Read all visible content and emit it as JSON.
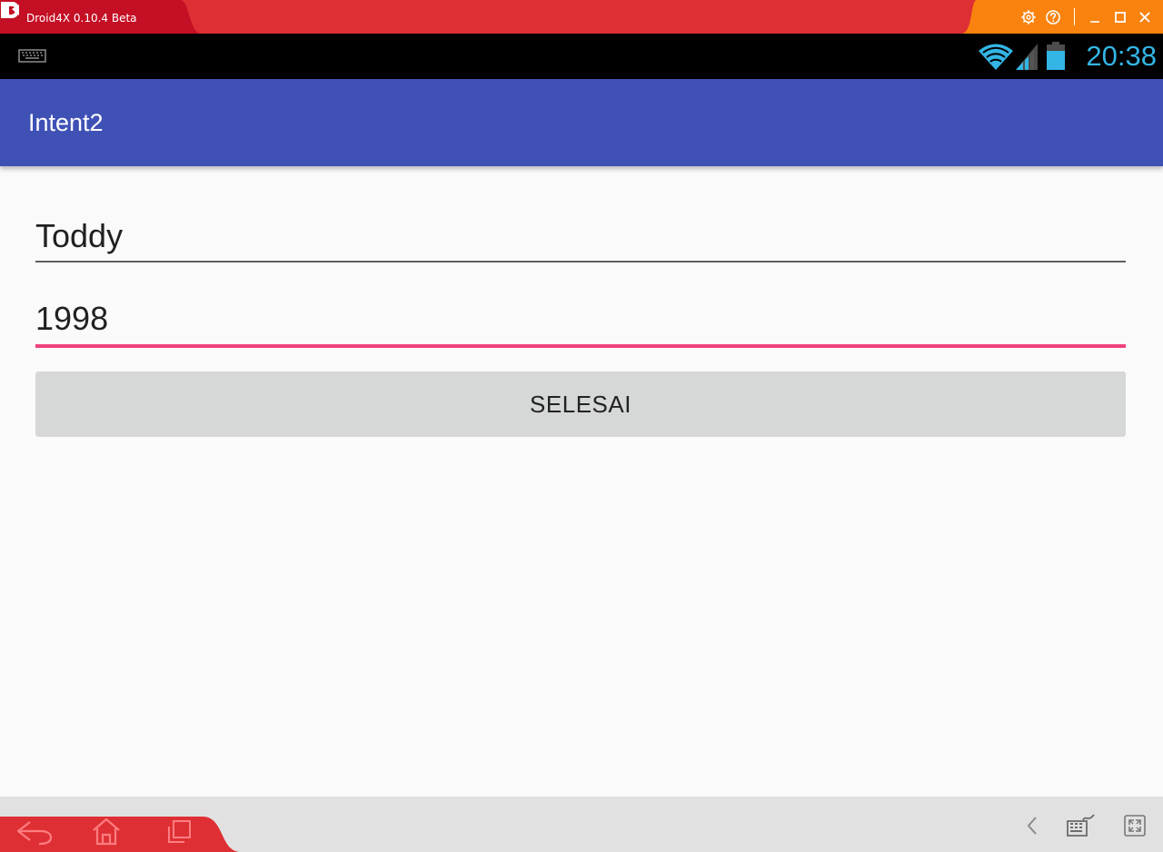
{
  "titlebar": {
    "app_title": "Droid4X 0.10.4 Beta",
    "logo_icon": "droid4x-logo-icon",
    "buttons": [
      "settings-icon",
      "help-icon",
      "minimize-icon",
      "maximize-icon",
      "close-icon"
    ]
  },
  "statusbar": {
    "time": "20:38",
    "icons": [
      "keyboard-icon",
      "wifi-icon",
      "signal-icon",
      "battery-icon"
    ]
  },
  "appbar": {
    "title": "Intent2"
  },
  "form": {
    "name_value": "Toddy",
    "year_value": "1998",
    "submit_label": "SELESAI"
  },
  "bottom_nav": {
    "icons": [
      "back-icon",
      "home-icon",
      "recent-apps-icon",
      "collapse-icon",
      "keyboard-mapper-icon",
      "fullscreen-icon"
    ]
  },
  "colors": {
    "titlebar_red": "#de3034",
    "titlebar_dark_red": "#c40f24",
    "window_controls_orange": "#f9830e",
    "statusbar": "#000000",
    "statusbar_accent": "#33b5e5",
    "app_bar": "#3f51b5",
    "focused_underline": "#f0417a",
    "button": "#d6d7d7"
  }
}
